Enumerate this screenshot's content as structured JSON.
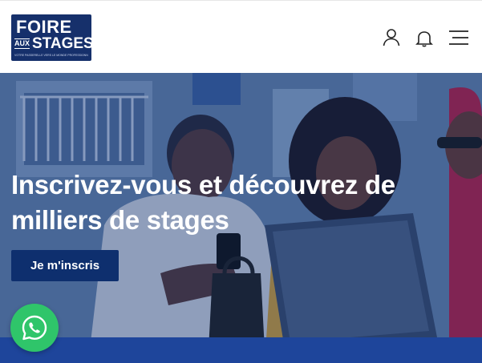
{
  "header": {
    "logo": {
      "line1": "FOIRE",
      "line2_small": "AUX",
      "line2": "STAGES",
      "tagline": "VOTRE PASSERELLE VERS LE MONDE PROFESSIONNEL"
    },
    "icons": [
      "user-icon",
      "bell-icon",
      "hamburger-menu-icon"
    ]
  },
  "hero": {
    "headline": "Inscrivez-vous et découvrez de milliers de stages",
    "cta_label": "Je m'inscris"
  },
  "floating": {
    "icon": "whatsapp-icon",
    "color": "#2fc56a"
  },
  "colors": {
    "brand": "#16306b",
    "button": "#0e2f6e"
  }
}
